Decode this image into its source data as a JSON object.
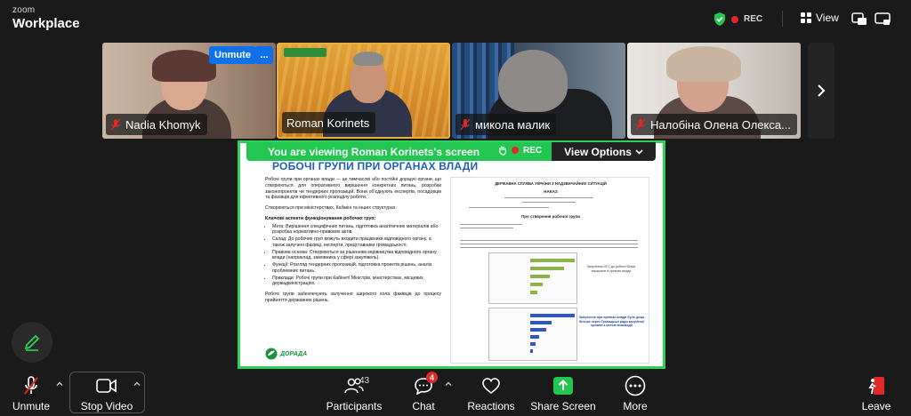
{
  "app": {
    "brand_top": "zoom",
    "brand_bottom": "Workplace",
    "rec_label": "REC",
    "view_label": "View"
  },
  "gallery": {
    "participants": [
      {
        "name": "Nadia Khomyk",
        "muted": true
      },
      {
        "name": "Roman Korinets",
        "muted": false
      },
      {
        "name": "микола малик",
        "muted": true
      },
      {
        "name": "Налобіна Олена Олекса...",
        "muted": true
      }
    ],
    "unmute_label": "Unmute",
    "more_label": "..."
  },
  "share": {
    "viewing_text": "You are viewing  Roman Korinets's screen",
    "rec_label": "REC",
    "view_options_label": "View Options"
  },
  "slide": {
    "title": "РОБОЧІ ГРУПИ ПРИ ОРГАНАХ ВЛАДИ",
    "intro": "Робочі групи при органах влади — це тимчасові або постійні дорадчі органи, що створюються для оперативного вирішення конкретних питань, розробки законопроектів чи тендерних пропозицій. Вони об'єднують експертів, посадовців та фахівців для ефективного розподілу роботи.",
    "created": "Створюються при міністерствах, Кабміні та інших структурах.",
    "aspects_heading": "Ключові аспекти функціонування робочих груп:",
    "aspects": [
      "Мета: Вирішення специфічних питань, підготовка аналітичних матеріалів або розробка нормативно-правових актів.",
      "Склад: До робочих груп можуть входити працівники відповідного органу, а також залучені фахівці, експерти, представники громадськості.",
      "Правова основа: Створюються за рішенням керівництва відповідного органу влади (наприклад, замовника у сфері закупівель).",
      "Функції: Розгляд тендерних пропозицій, підготовка проектів рішень, аналіз проблемних питань.",
      "Приклади: Робочі групи при Кабінеті Міністрів, міністерствах, місцевих держадміністраціях."
    ],
    "closing": "Робочі групи забезпечують залучення широкого кола фахівців до процесу прийняття державних рішень.",
    "logo_text": "ДОРАДА",
    "doc_header": "ДЕРЖАВНА СЛУЖБА УКРАЇНИ З НАДЗВИЧАЙНИХ СИТУАЦІЙ",
    "doc_order": "НАКАЗ",
    "doc_subject": "Про створення робочої групи",
    "grey_note": "Залучення ОГС до роботи більш поширене в органах влади",
    "blue_note": "Залучення при органах влади було дещо більше через Громадські ради залученої органів з метою взаємодії"
  },
  "toolbar": {
    "unmute": "Unmute",
    "stop_video": "Stop Video",
    "participants": "Participants",
    "participants_count": "43",
    "chat": "Chat",
    "chat_badge": "4",
    "reactions": "Reactions",
    "share_screen": "Share Screen",
    "more": "More",
    "leave": "Leave"
  },
  "colors": {
    "accent_green": "#2fd157",
    "zoom_blue": "#0e71eb",
    "rec_red": "#e02828",
    "slide_title_blue": "#1e5fb8"
  }
}
